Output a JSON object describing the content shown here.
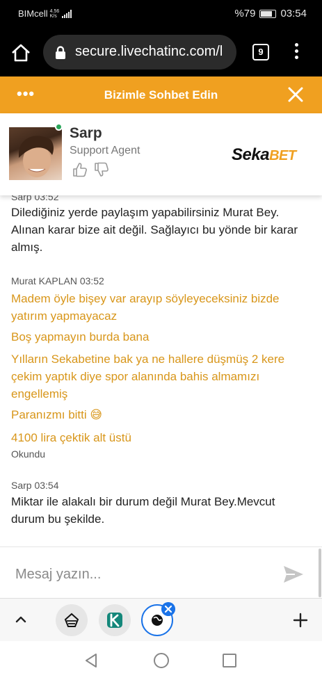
{
  "status_bar": {
    "carrier": "BIMcell",
    "network_speed_top": "4.56",
    "network_speed_bottom": "K/s",
    "battery": "%79",
    "time": "03:54"
  },
  "browser": {
    "url": "secure.livechatinc.com/l",
    "tab_count": "9"
  },
  "chat_header": {
    "menu_dots": "•••",
    "title": "Bizimle Sohbet Edin"
  },
  "agent": {
    "name": "Sarp",
    "role": "Support Agent",
    "brand_part1": "Seka",
    "brand_part2": "BET"
  },
  "messages": [
    {
      "meta": "Sarp 03:52",
      "lines": [
        "Dilediğiniz yerde paylaşım yapabilirsiniz Murat Bey. Alınan karar bize ait değil. Sağlayıcı bu yönde bir karar almış."
      ]
    },
    {
      "meta": "Murat KAPLAN 03:52",
      "lines": [
        "Madem öyle bişey var arayıp söyleyeceksiniz bizde yatırım yapmayacaz",
        "Boş yapmayın burda bana",
        "Yılların Sekabetine bak ya ne hallere düşmüş 2 kere çekim yaptık diye spor alanında bahis almamızı engellemiş",
        "Paranızmı bitti 😅",
        "4100 lira çektik alt üstü"
      ],
      "status": "Okundu"
    },
    {
      "meta": "Sarp 03:54",
      "lines": [
        "Miktar ile alakalı bir durum değil Murat Bey.Mevcut durum bu şekilde."
      ]
    }
  ],
  "input": {
    "placeholder": "Mesaj yazın..."
  }
}
